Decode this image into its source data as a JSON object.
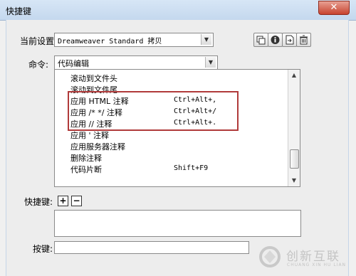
{
  "window": {
    "title": "快捷键",
    "close_glyph": "✕"
  },
  "current_setting": {
    "label": "当前设置:",
    "value": "Dreamweaver Standard 拷贝"
  },
  "command": {
    "label": "命令:",
    "value": "代码编辑"
  },
  "toolbar": {
    "icons": [
      "duplicate-set-icon",
      "info-icon",
      "export-icon",
      "delete-icon"
    ]
  },
  "commands_list": [
    {
      "name": "滚动到文件头",
      "shortcut": ""
    },
    {
      "name": "滚动到文件尾",
      "shortcut": ""
    },
    {
      "name": "应用 HTML 注释",
      "shortcut": "Ctrl+Alt+,"
    },
    {
      "name": "应用 /* */ 注释",
      "shortcut": "Ctrl+Alt+/"
    },
    {
      "name": "应用 // 注释",
      "shortcut": "Ctrl+Alt+."
    },
    {
      "name": "应用 ' 注释",
      "shortcut": ""
    },
    {
      "name": "应用服务器注释",
      "shortcut": ""
    },
    {
      "name": "删除注释",
      "shortcut": ""
    },
    {
      "name": "代码片断",
      "shortcut": "Shift+F9"
    }
  ],
  "shortcut_section": {
    "label": "快捷键:",
    "add": "+",
    "remove": "−"
  },
  "press_key": {
    "label": "按键:",
    "value": ""
  },
  "watermark": {
    "brand": "创新互联",
    "sub": "CHUANG XIN HU LIAN"
  },
  "colors": {
    "highlight_border": "#b03a3a",
    "title_bg": "#d2e3f5"
  }
}
